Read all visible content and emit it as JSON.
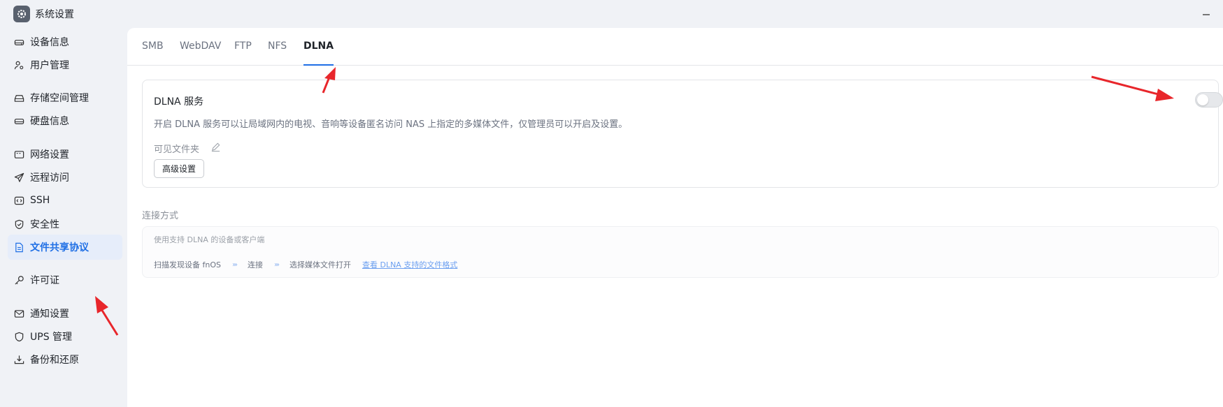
{
  "window": {
    "title": "系统设置"
  },
  "sidebar": {
    "items": [
      {
        "label": "设备信息",
        "icon": "hard-drive-icon",
        "active": false
      },
      {
        "label": "用户管理",
        "icon": "users-icon",
        "active": false
      },
      {
        "label": "存储空间管理",
        "icon": "storage-icon",
        "active": false
      },
      {
        "label": "硬盘信息",
        "icon": "disk-icon",
        "active": false
      },
      {
        "label": "网络设置",
        "icon": "network-icon",
        "active": false
      },
      {
        "label": "远程访问",
        "icon": "send-icon",
        "active": false
      },
      {
        "label": "SSH",
        "icon": "code-icon",
        "active": false
      },
      {
        "label": "安全性",
        "icon": "shield-check-icon",
        "active": false
      },
      {
        "label": "文件共享协议",
        "icon": "document-icon",
        "active": true
      },
      {
        "label": "许可证",
        "icon": "key-icon",
        "active": false
      },
      {
        "label": "通知设置",
        "icon": "mail-icon",
        "active": false
      },
      {
        "label": "UPS 管理",
        "icon": "shield-icon",
        "active": false
      },
      {
        "label": "备份和还原",
        "icon": "backup-icon",
        "active": false
      }
    ]
  },
  "tabs": [
    {
      "label": "SMB",
      "active": false
    },
    {
      "label": "WebDAV",
      "active": false
    },
    {
      "label": "FTP",
      "active": false
    },
    {
      "label": "NFS",
      "active": false
    },
    {
      "label": "DLNA",
      "active": true
    }
  ],
  "dlna": {
    "title": "DLNA 服务",
    "description": "开启 DLNA 服务可以让局域网内的电视、音响等设备匿名访问 NAS 上指定的多媒体文件，仅管理员可以开启及设置。",
    "folder_label": "可见文件夹",
    "advanced_button": "高级设置",
    "enabled": false
  },
  "connection": {
    "label": "连接方式",
    "description": "使用支持 DLNA 的设备或客户端",
    "steps": [
      "扫描发现设备 fnOS",
      "连接",
      "选择媒体文件打开"
    ],
    "link": "查看 DLNA 支持的文件格式"
  },
  "colors": {
    "accent": "#1f6fe5",
    "annotation_arrow": "#e8262b"
  }
}
